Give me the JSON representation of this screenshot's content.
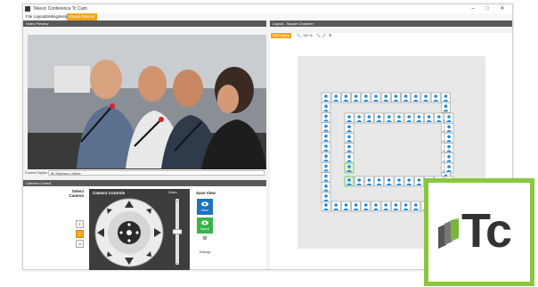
{
  "window": {
    "title": "Televic Conference Tc Cam",
    "controls": [
      "–",
      "□",
      "✕"
    ]
  },
  "menu": [
    {
      "label": "File",
      "active": false
    },
    {
      "label": "Layout",
      "active": false
    },
    {
      "label": "Settings",
      "active": false
    },
    {
      "label": "Help",
      "active": false
    },
    {
      "label": "Virtual Director",
      "active": true
    }
  ],
  "video_panel": {
    "title": "Video Preview"
  },
  "current_caption": {
    "label": "Current Caption",
    "value": "Bit Stéphane Lefèbre"
  },
  "camera_control": {
    "title": "Camera Control",
    "select_camera_label": "Select Camera",
    "cameras": [
      {
        "label": "1",
        "selected": false
      },
      {
        "label": "2",
        "selected": true
      },
      {
        "label": "3",
        "selected": false
      }
    ],
    "controls_title": "Camera Controls",
    "zoom_label": "Zoom",
    "zoom_level": 0.5,
    "save_view_title": "Save View",
    "save_button_label": "Save",
    "saved_button_label": "Saved",
    "settings_label": "Settings"
  },
  "layout_panel": {
    "title": "Layout - Square Chamber",
    "toolbar": {
      "edit_label": "Edit Layout",
      "zoom_text": "100 %"
    }
  },
  "colors": {
    "accent": "#f4a51b",
    "panel_header": "#595959",
    "blue_button": "#1e73be",
    "green_button": "#38b449",
    "seat_blue": "#2288d8",
    "logo_border": "#8cc63f"
  },
  "logo": {
    "text": "Tc"
  }
}
